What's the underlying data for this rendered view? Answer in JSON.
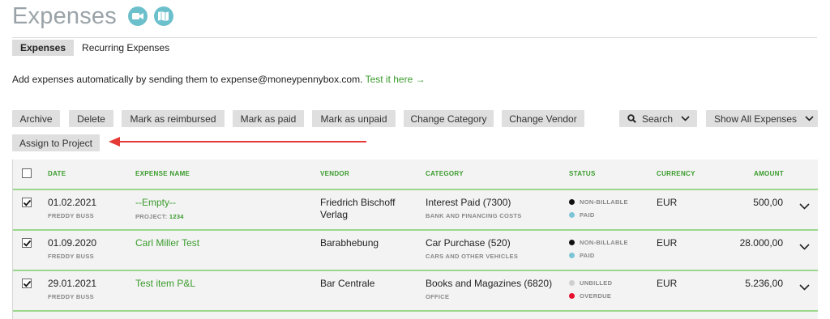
{
  "page": {
    "title": "Expenses"
  },
  "tabs": [
    {
      "label": "Expenses"
    },
    {
      "label": "Recurring Expenses"
    }
  ],
  "info": {
    "text": "Add expenses automatically by sending them to expense@moneypennybox.com.",
    "link": "Test it here →"
  },
  "toolbar": {
    "archive": "Archive",
    "delete": "Delete",
    "mark_reimbursed": "Mark as reimbursed",
    "mark_paid": "Mark as paid",
    "mark_unpaid": "Mark as unpaid",
    "change_category": "Change Category",
    "change_vendor": "Change Vendor",
    "search": "Search",
    "show_all": "Show All Expenses",
    "assign_project": "Assign to Project"
  },
  "table": {
    "headers": {
      "date": "DATE",
      "name": "EXPENSE NAME",
      "vendor": "VENDOR",
      "category": "CATEGORY",
      "status": "STATUS",
      "currency": "CURRENCY",
      "amount": "AMOUNT"
    },
    "rows": [
      {
        "date": "01.02.2021",
        "person": "FREDDY BUSS",
        "name": "--Empty--",
        "project_label": "PROJECT:",
        "project_value": "1234",
        "vendor_line1": "Friedrich Bischoff",
        "vendor_line2": "Verlag",
        "category": "Interest Paid (7300)",
        "category_sub": "BANK AND FINANCING COSTS",
        "status1": "NON-BILLABLE",
        "status2": "PAID",
        "currency": "EUR",
        "amount": "500,00"
      },
      {
        "date": "01.09.2020",
        "person": "FREDDY BUSS",
        "name": "Carl Miller Test",
        "vendor_line1": "Barabhebung",
        "category": "Car Purchase (520)",
        "category_sub": "CARS AND OTHER VEHICLES",
        "status1": "NON-BILLABLE",
        "status2": "PAID",
        "currency": "EUR",
        "amount": "28.000,00"
      },
      {
        "date": "29.01.2021",
        "person": "FREDDY BUSS",
        "name": "Test item P&L",
        "vendor_line1": "Bar Centrale",
        "category": "Books and Magazines (6820)",
        "category_sub": "OFFICE",
        "status1": "UNBILLED",
        "status2": "OVERDUE",
        "currency": "EUR",
        "amount": "5.236,00"
      }
    ]
  },
  "colors": {
    "accent_green": "#3a9b2c",
    "icon_teal": "#6cc0cc",
    "annotation_arrow": "#e53935",
    "status_black": "#111111",
    "status_blue": "#7cc4d6",
    "status_grey": "#cfcfcf",
    "status_red": "#e8112d"
  },
  "icons": [
    "video-camera-icon",
    "map-icon",
    "search-icon",
    "chevron-down-icon",
    "checkmark-icon"
  ]
}
